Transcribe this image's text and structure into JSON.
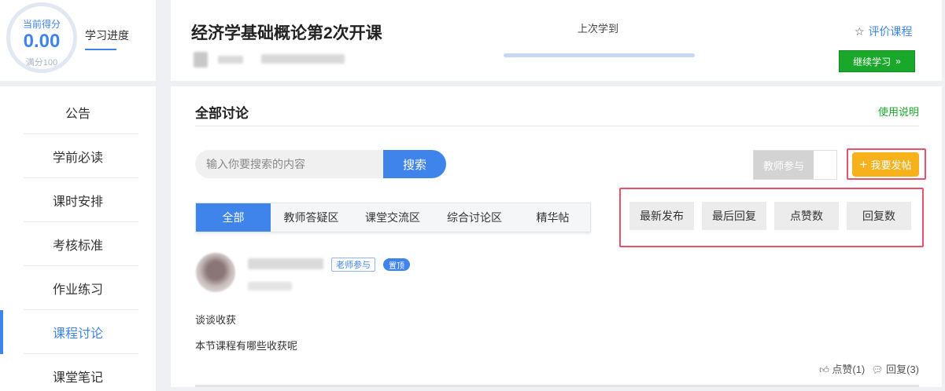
{
  "score": {
    "top_label": "当前得分",
    "value": "0.00",
    "bottom_label": "满分100",
    "progress_label": "学习进度"
  },
  "sidebar": {
    "items": [
      {
        "label": "公告"
      },
      {
        "label": "学前必读"
      },
      {
        "label": "课时安排"
      },
      {
        "label": "考核标准"
      },
      {
        "label": "作业练习"
      },
      {
        "label": "课程讨论"
      },
      {
        "label": "课堂笔记"
      }
    ],
    "active_index": 5
  },
  "header": {
    "course_title": "经济学基础概论第2次开课",
    "last_learned_label": "上次学到",
    "rate_label": "评价课程",
    "continue_label": "继续学习",
    "icons": {
      "rate": "star-outline-icon",
      "continue": "double-chevron-right-icon"
    }
  },
  "discussion": {
    "title": "全部讨论",
    "help_link": "使用说明",
    "search": {
      "placeholder": "输入你要搜索的内容",
      "button_label": "搜索"
    },
    "teacher_toggle_label": "教师参与",
    "post_button_label": "我要发帖",
    "tabs": [
      {
        "label": "全部"
      },
      {
        "label": "教师答疑区"
      },
      {
        "label": "课堂交流区"
      },
      {
        "label": "综合讨论区"
      },
      {
        "label": "精华帖"
      }
    ],
    "active_tab": 0,
    "sort_options": [
      {
        "label": "最新发布"
      },
      {
        "label": "最后回复"
      },
      {
        "label": "点赞数"
      },
      {
        "label": "回复数"
      }
    ],
    "post": {
      "badge_teacher": "老师参与",
      "badge_top": "置顶",
      "title": "谈谈收获",
      "body": "本节课程有哪些收获呢",
      "likes_label": "点赞(1)",
      "replies_label": "回复(3)"
    }
  },
  "colors": {
    "primary": "#3f84ea",
    "green": "#1aa82b",
    "orange": "#f7b21b",
    "highlight": "#e9526c"
  }
}
